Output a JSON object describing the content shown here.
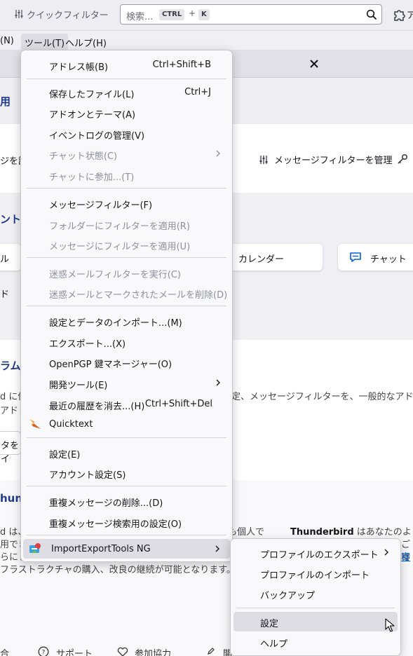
{
  "toolbar": {
    "quick_filter": "クイックフィルター",
    "search_placeholder": "検索...",
    "kbd_ctrl": "CTRL",
    "kbd_plus": "+",
    "kbd_k": "K",
    "addons_label": "ア"
  },
  "menubar": {
    "n": "(N)",
    "tools": "ツール(T)",
    "help": "ヘルプ(H)"
  },
  "background": {
    "page_title": "用",
    "read_label": "ジを読",
    "filter_action": "メッセージフィルターを管理",
    "acct_title": "ント行",
    "card_mail": "ル",
    "card_calendar": "カレンダー",
    "card_chat": "チャット",
    "card_feed": "ド",
    "sec1_title": "ラムカ",
    "sec1_text1": "d に他",
    "sec1_text1_right": "定、メッセージフィルターを、一般的なアドレス",
    "sec1_text2": "アドレス",
    "sec1_button": "タをイ",
    "sec2_title": "hund",
    "sec2_text1": "d は、",
    "sec2_text1_right": "でも個人で",
    "sec2_text2": "用でき",
    "sec2_text3": "らにし",
    "sec2_text4": "フラストラクチャの購入、改良の継続が可能となります。",
    "sec2_right_bold": "Thunderbird",
    "sec2_right_rest": " はあなたのような",
    "sec2_right2": "ご検",
    "sec2_link": "寄",
    "footer_a": "合",
    "footer_support": "サポート",
    "footer_donate": "参加協力",
    "footer_sec": "開"
  },
  "menu": {
    "items": [
      {
        "label": "アドレス帳(B)",
        "shortcut": "Ctrl+Shift+B",
        "disabled": false
      },
      {
        "label": "保存したファイル(L)",
        "shortcut": "Ctrl+J",
        "disabled": false
      },
      {
        "label": "アドオンとテーマ(A)",
        "shortcut": "",
        "disabled": false
      },
      {
        "label": "イベントログの管理(V)",
        "shortcut": "",
        "disabled": false
      },
      {
        "label": "チャット状態(C)",
        "shortcut": "",
        "disabled": true
      },
      {
        "label": "チャットに参加...(T)",
        "shortcut": "",
        "disabled": true
      },
      {
        "label": "メッセージフィルター(F)",
        "shortcut": "",
        "disabled": false
      },
      {
        "label": "フォルダーにフィルターを適用(R)",
        "shortcut": "",
        "disabled": true
      },
      {
        "label": "メッセージにフィルターを適用(U)",
        "shortcut": "",
        "disabled": true
      },
      {
        "label": "迷惑メールフィルターを実行(C)",
        "shortcut": "",
        "disabled": true
      },
      {
        "label": "迷惑メールとマークされたメールを削除(D)",
        "shortcut": "",
        "disabled": true
      },
      {
        "label": "設定とデータのインポート...(M)",
        "shortcut": "",
        "disabled": false
      },
      {
        "label": "エクスポート...(X)",
        "shortcut": "",
        "disabled": false
      },
      {
        "label": "OpenPGP 鍵マネージャー(O)",
        "shortcut": "",
        "disabled": false
      },
      {
        "label": "開発ツール(E)",
        "shortcut": "",
        "disabled": false
      },
      {
        "label": "最近の履歴を消去...(H)",
        "shortcut": "Ctrl+Shift+Del",
        "disabled": false
      },
      {
        "label": "Quicktext",
        "shortcut": "",
        "disabled": false
      },
      {
        "label": "設定(E)",
        "shortcut": "",
        "disabled": false
      },
      {
        "label": "アカウント設定(S)",
        "shortcut": "",
        "disabled": false
      },
      {
        "label": "重複メッセージの削除...(D)",
        "shortcut": "",
        "disabled": false
      },
      {
        "label": "重複メッセージ検索用の設定(O)",
        "shortcut": "",
        "disabled": false
      },
      {
        "label": "ImportExportTools NG",
        "shortcut": "",
        "disabled": false
      }
    ]
  },
  "submenu": {
    "items": [
      {
        "label": "プロファイルのエクスポート"
      },
      {
        "label": "プロファイルのインポート"
      },
      {
        "label": "バックアップ"
      },
      {
        "label": "設定"
      },
      {
        "label": "ヘルプ"
      }
    ]
  },
  "colors": {
    "accent": "#0060df",
    "heading": "#1e3a8a",
    "hover": "#dddde3",
    "disabled": "#8f8f9d"
  }
}
